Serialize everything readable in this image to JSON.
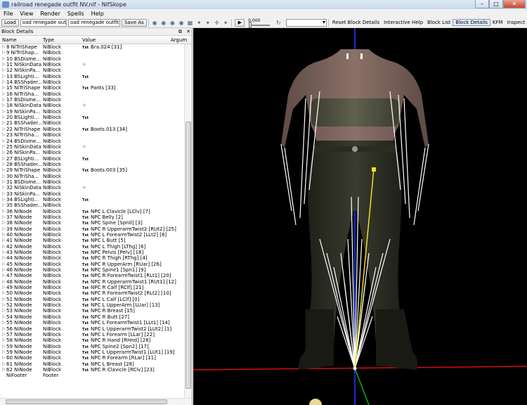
{
  "window": {
    "title": "railroad renegade outfit NV.nif - NifSkope"
  },
  "menu": [
    "File",
    "View",
    "Render",
    "Spells",
    "Help"
  ],
  "toolbar": {
    "load_label": "Load",
    "load_path": "oad renegade outfit NV.nif",
    "save_path": "oad renegade outfit NV.nif",
    "save_as_label": "Save As",
    "anim_time": "0.000",
    "links": [
      "Reset Block Details",
      "Interactive Help",
      "Block List",
      "Block Details",
      "KFM",
      "Inspect"
    ]
  },
  "panel": {
    "title": "Block Details",
    "columns": [
      "Name",
      "Type",
      "Value",
      "Argum"
    ]
  },
  "rows": [
    {
      "name": "8 NiTriShape",
      "type": "NiBlock",
      "value": "Bra.024 [31]",
      "icon": "txt"
    },
    {
      "name": "9 NiTriShap...",
      "type": "NiBlock",
      "value": "",
      "icon": ""
    },
    {
      "name": "10 BSDisme...",
      "type": "NiBlock",
      "value": "",
      "icon": ""
    },
    {
      "name": "11 NiSkinData",
      "type": "NiBlock",
      "value": "",
      "icon": "star"
    },
    {
      "name": "12 NiSkinPa...",
      "type": "NiBlock",
      "value": "",
      "icon": ""
    },
    {
      "name": "13 BSLighti...",
      "type": "NiBlock",
      "value": "",
      "icon": "txt"
    },
    {
      "name": "14 BSShader...",
      "type": "NiBlock",
      "value": "",
      "icon": ""
    },
    {
      "name": "15 NiTriShape",
      "type": "NiBlock",
      "value": "Pants [33]",
      "icon": "txt"
    },
    {
      "name": "16 NiTriSha...",
      "type": "NiBlock",
      "value": "",
      "icon": ""
    },
    {
      "name": "17 BSDisme...",
      "type": "NiBlock",
      "value": "",
      "icon": ""
    },
    {
      "name": "18 NiSkinData",
      "type": "NiBlock",
      "value": "",
      "icon": "star"
    },
    {
      "name": "19 NiSkinPa...",
      "type": "NiBlock",
      "value": "",
      "icon": ""
    },
    {
      "name": "20 BSLighti...",
      "type": "NiBlock",
      "value": "",
      "icon": "txt"
    },
    {
      "name": "21 BSShader...",
      "type": "NiBlock",
      "value": "",
      "icon": ""
    },
    {
      "name": "22 NiTriShape",
      "type": "NiBlock",
      "value": "Boots.013 [34]",
      "icon": "txt"
    },
    {
      "name": "23 NiTriSha...",
      "type": "NiBlock",
      "value": "",
      "icon": ""
    },
    {
      "name": "24 BSDisme...",
      "type": "NiBlock",
      "value": "",
      "icon": ""
    },
    {
      "name": "25 NiSkinData",
      "type": "NiBlock",
      "value": "",
      "icon": "star"
    },
    {
      "name": "26 NiSkinPa...",
      "type": "NiBlock",
      "value": "",
      "icon": ""
    },
    {
      "name": "27 BSLighti...",
      "type": "NiBlock",
      "value": "",
      "icon": "txt"
    },
    {
      "name": "28 BSShader...",
      "type": "NiBlock",
      "value": "",
      "icon": ""
    },
    {
      "name": "29 NiTriShape",
      "type": "NiBlock",
      "value": "Boots.003 [35]",
      "icon": "txt"
    },
    {
      "name": "30 NiTriSha...",
      "type": "NiBlock",
      "value": "",
      "icon": ""
    },
    {
      "name": "31 BSDisme...",
      "type": "NiBlock",
      "value": "",
      "icon": ""
    },
    {
      "name": "32 NiSkinData",
      "type": "NiBlock",
      "value": "",
      "icon": "star"
    },
    {
      "name": "33 NiSkinPa...",
      "type": "NiBlock",
      "value": "",
      "icon": ""
    },
    {
      "name": "34 BSLighti...",
      "type": "NiBlock",
      "value": "",
      "icon": "txt"
    },
    {
      "name": "35 BSShader...",
      "type": "NiBlock",
      "value": "",
      "icon": ""
    },
    {
      "name": "36 NiNode",
      "type": "NiBlock",
      "value": "NPC L Clavicle [LClv] [7]",
      "icon": "txt"
    },
    {
      "name": "37 NiNode",
      "type": "NiBlock",
      "value": "NPC Belly [2]",
      "icon": "txt"
    },
    {
      "name": "38 NiNode",
      "type": "NiBlock",
      "value": "NPC Spine [Spn0] [3]",
      "icon": "txt"
    },
    {
      "name": "39 NiNode",
      "type": "NiBlock",
      "value": "NPC R UpperarmTwist2 [RUt2] [25]",
      "icon": "txt"
    },
    {
      "name": "40 NiNode",
      "type": "NiBlock",
      "value": "NPC L ForearmTwist2 [LLt2] [8]",
      "icon": "txt"
    },
    {
      "name": "41 NiNode",
      "type": "NiBlock",
      "value": "NPC L Butt [5]",
      "icon": "txt"
    },
    {
      "name": "42 NiNode",
      "type": "NiBlock",
      "value": "NPC L Thigh [LThg] [6]",
      "icon": "txt"
    },
    {
      "name": "43 NiNode",
      "type": "NiBlock",
      "value": "NPC Pelvis [Pelv] [18]",
      "icon": "txt"
    },
    {
      "name": "44 NiNode",
      "type": "NiBlock",
      "value": "NPC R Thigh [RThg] [4]",
      "icon": "txt"
    },
    {
      "name": "45 NiNode",
      "type": "NiBlock",
      "value": "NPC R UpperArm [RUar] [26]",
      "icon": "txt"
    },
    {
      "name": "46 NiNode",
      "type": "NiBlock",
      "value": "NPC Spine1 [Spn1] [9]",
      "icon": "txt"
    },
    {
      "name": "47 NiNode",
      "type": "NiBlock",
      "value": "NPC R ForearmTwist1 [RLt1] [20]",
      "icon": "txt"
    },
    {
      "name": "48 NiNode",
      "type": "NiBlock",
      "value": "NPC R UpperarmTwist1 [RUt1] [12]",
      "icon": "txt"
    },
    {
      "name": "49 NiNode",
      "type": "NiBlock",
      "value": "NPC R Calf [RClf] [21]",
      "icon": "txt"
    },
    {
      "name": "50 NiNode",
      "type": "NiBlock",
      "value": "NPC R ForearmTwist2 [RLt2] [10]",
      "icon": "txt"
    },
    {
      "name": "51 NiNode",
      "type": "NiBlock",
      "value": "NPC L Calf [LClf] [0]",
      "icon": "txt"
    },
    {
      "name": "52 NiNode",
      "type": "NiBlock",
      "value": "NPC L UpperArm [LUar] [13]",
      "icon": "txt"
    },
    {
      "name": "53 NiNode",
      "type": "NiBlock",
      "value": "NPC R Breast [15]",
      "icon": "txt"
    },
    {
      "name": "54 NiNode",
      "type": "NiBlock",
      "value": "NPC R Butt [27]",
      "icon": "txt"
    },
    {
      "name": "55 NiNode",
      "type": "NiBlock",
      "value": "NPC L ForearmTwist1 [LLt1] [14]",
      "icon": "txt"
    },
    {
      "name": "56 NiNode",
      "type": "NiBlock",
      "value": "NPC L UpperarmTwist2 [LUt2] [1]",
      "icon": "txt"
    },
    {
      "name": "57 NiNode",
      "type": "NiBlock",
      "value": "NPC L Forearm [LLar] [22]",
      "icon": "txt"
    },
    {
      "name": "58 NiNode",
      "type": "NiBlock",
      "value": "NPC R Hand [RHnd] [28]",
      "icon": "txt"
    },
    {
      "name": "59 NiNode",
      "type": "NiBlock",
      "value": "NPC Spine2 [Spn2] [17]",
      "icon": "txt"
    },
    {
      "name": "59 NiNode",
      "type": "NiBlock",
      "value": "NPC L UpperarmTwist1 [LUt1] [19]",
      "icon": "txt"
    },
    {
      "name": "60 NiNode",
      "type": "NiBlock",
      "value": "NPC R Forearm [RLar] [11]",
      "icon": "txt"
    },
    {
      "name": "61 NiNode",
      "type": "NiBlock",
      "value": "NPC L Breast [28]",
      "icon": "txt"
    },
    {
      "name": "62 NiNode",
      "type": "NiBlock",
      "value": "NPC R Clavicle [RClv] [23]",
      "icon": "txt"
    },
    {
      "name": "NiFooter",
      "type": "Footer",
      "value": "",
      "icon": ""
    }
  ],
  "txt_badge": "Txt",
  "star_glyph": "✳",
  "twisty_glyph": "▷"
}
